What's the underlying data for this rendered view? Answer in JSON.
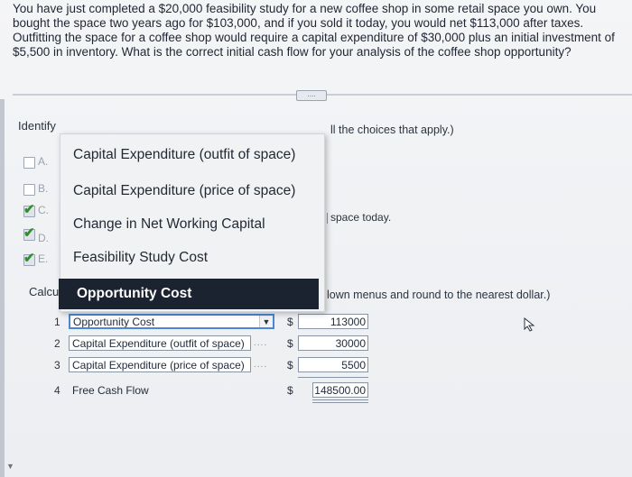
{
  "question": "You have just completed a $20,000 feasibility study for a new coffee shop in some retail space you own. You bought the space two years ago for $103,000, and if you sold it today, you would net $113,000 after taxes. Outfitting the space for a coffee shop would require a capital expenditure of $30,000 plus an initial investment of $5,500 in inventory. What is the correct initial cash flow for your analysis of the coffee shop opportunity?",
  "identify_label": "Identify",
  "apply_fragment": "ll the choices that apply.)",
  "space_today_fragment": "space today.",
  "calculate_label": "Calcula",
  "dropdown_fragment": "lown menus and round to the nearest dollar.)",
  "handle_glyph": "....",
  "options": [
    {
      "letter": "A.",
      "checked": false
    },
    {
      "letter": "B.",
      "checked": false
    },
    {
      "letter": "C.",
      "checked": true
    },
    {
      "letter": "D.",
      "checked": true
    },
    {
      "letter": "E.",
      "checked": true
    }
  ],
  "popup_items": [
    "Capital Expenditure (outfit of space)",
    "Capital Expenditure (price of space)",
    "Change in Net Working Capital",
    "Feasibility Study Cost",
    "Opportunity Cost"
  ],
  "rows": [
    {
      "num": "1",
      "label": "Opportunity Cost",
      "currency": "$",
      "amount": "113000"
    },
    {
      "num": "2",
      "label": "Capital Expenditure (outfit of space)",
      "currency": "$",
      "amount": "30000"
    },
    {
      "num": "3",
      "label": "Capital Expenditure (price of space)",
      "currency": "$",
      "amount": "5500"
    },
    {
      "num": "4",
      "label": "Free Cash Flow",
      "currency": "$",
      "amount": "148500.00"
    }
  ],
  "dropdown_arrow": "▼",
  "check_glyph": "✔",
  "colors": {
    "selected_bg": "#1b2330",
    "active_border": "#4b87d6",
    "check": "#2f8f2f"
  }
}
